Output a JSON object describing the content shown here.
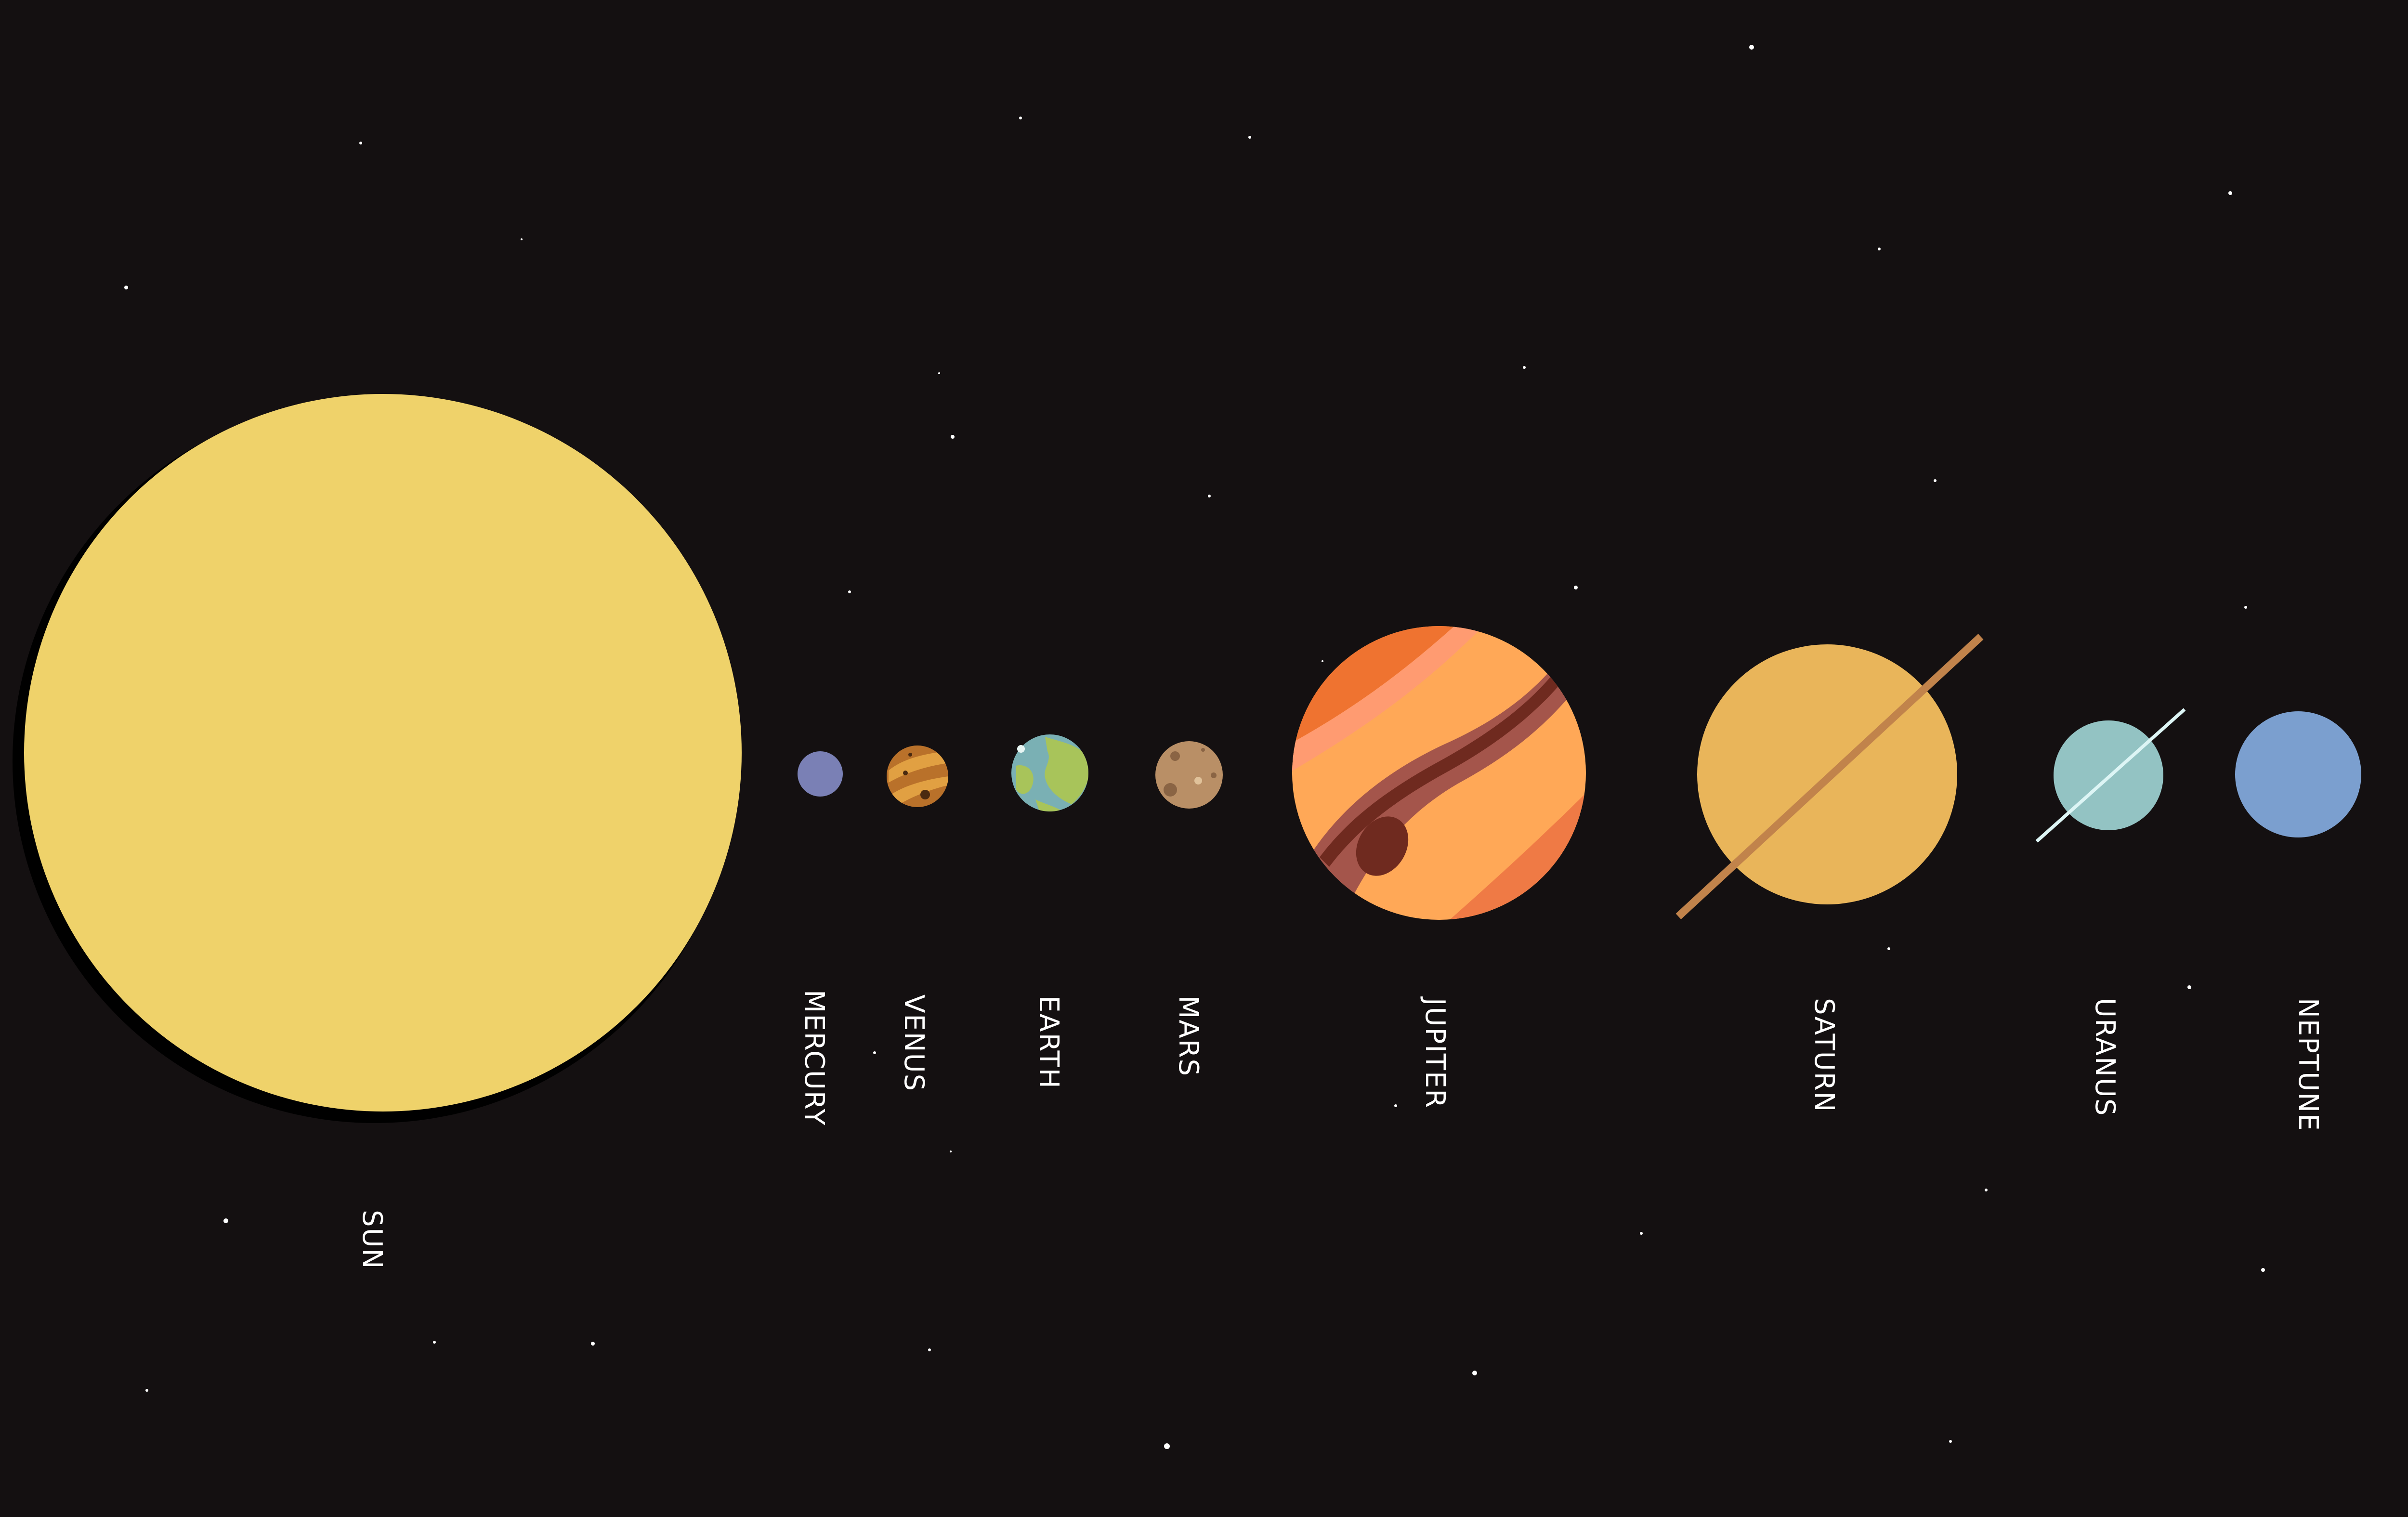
{
  "bodies": [
    {
      "name": "SUN",
      "color": "#EFD26A"
    },
    {
      "name": "MERCURY",
      "color": "#7A80B5"
    },
    {
      "name": "VENUS",
      "color": "#B9712A"
    },
    {
      "name": "EARTH",
      "color": "#7AB0B4"
    },
    {
      "name": "MARS",
      "color": "#B98F66"
    },
    {
      "name": "JUPITER",
      "color": "#FFA857"
    },
    {
      "name": "SATURN",
      "color": "#E9B55A"
    },
    {
      "name": "URANUS",
      "color": "#93C3C3"
    },
    {
      "name": "NEPTUNE",
      "color": "#7B9FCF"
    }
  ],
  "colors": {
    "background": "#141011",
    "star": "#ffffff",
    "saturn_ring": "#C1834B",
    "uranus_ring": "#DDF5F5"
  }
}
